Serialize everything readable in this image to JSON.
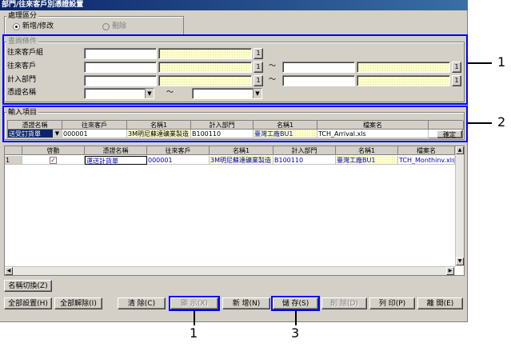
{
  "window": {
    "title": "部門/往來客戶別憑證設置"
  },
  "mode_group": {
    "title": "處理區分",
    "option_add": "新增/修改",
    "option_delete": "刪除"
  },
  "query_group": {
    "title": "查詢條件",
    "customer_group_label": "往來客戶組",
    "customer_label": "往來客戶",
    "dept_label": "計入部門",
    "voucher_label": "憑證名稱",
    "lookup_btn": "1",
    "tilde": "～"
  },
  "input_group": {
    "title": "輸入項目",
    "headers": [
      "憑證名稱",
      "往來客戶",
      "名稱1",
      "計入部門",
      "名稱1",
      "檔案名"
    ],
    "row": {
      "voucher": "送受訂貨單",
      "customer": "000001",
      "name1": "3M明尼蘇達礦業製造",
      "dept": "B100110",
      "name2": "臺灣工廠BU1",
      "file": "TCH_Arrival.xls"
    },
    "confirm_btn": "確定"
  },
  "list_grid": {
    "headers": [
      "",
      "啓動",
      "憑證名稱",
      "往來客戶",
      "名稱1",
      "計入部門",
      "名稱1",
      "檔案名"
    ],
    "rows": [
      {
        "no": "1",
        "voucher": "運送計貨單",
        "customer": "000001",
        "name1": "3M明尼蘇達礦業製造",
        "dept": "B100110",
        "name2": "臺灣工廠BU1",
        "file": "TCH_Monthinv.xls"
      }
    ]
  },
  "buttons": {
    "name_switch": "名稱切換(Z)",
    "set_all": "全部設置(H)",
    "clear_all": "全部解除(I)",
    "clear": "清 除(C)",
    "show": "顯 示(X)",
    "new": "新 增(N)",
    "save": "儲 存(S)",
    "delete": "削 除(D)",
    "print": "列 印(P)",
    "close": "離 開(E)"
  },
  "callouts": {
    "c1": "1",
    "c2": "2",
    "c1b": "1",
    "c3": "3"
  },
  "colors": {
    "callout": "#0000ff",
    "title_bar": "#0a246a",
    "window_bg": "#d4d0c8"
  }
}
